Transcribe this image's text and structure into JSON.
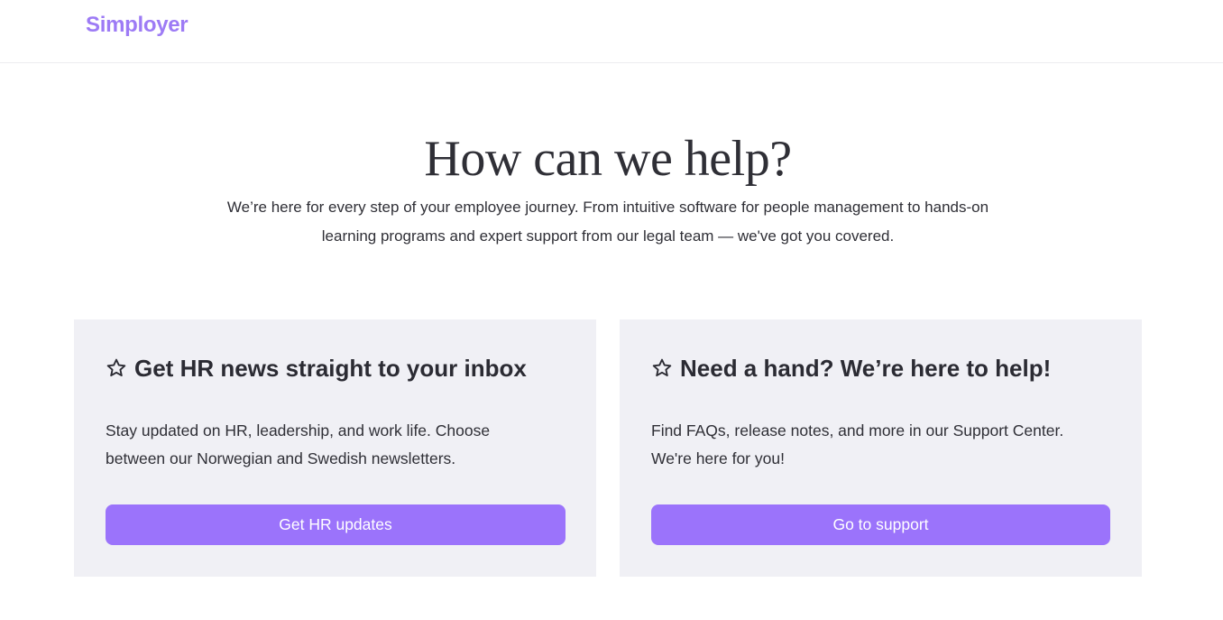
{
  "header": {
    "logo_text": "Simployer"
  },
  "hero": {
    "title": "How can we help?",
    "subtitle_line1": "We’re here for every step of your employee journey. From intuitive software for people management to hands-on",
    "subtitle_line2": "learning programs and expert support from our legal team — we've got you covered."
  },
  "cards": [
    {
      "icon": "star-icon",
      "title": "Get HR news straight to your inbox",
      "text_line1": "Stay updated on HR, leadership, and work life. Choose",
      "text_line2": "between our Norwegian and Swedish newsletters.",
      "button_label": "Get HR updates"
    },
    {
      "icon": "star-icon",
      "title": "Need a hand? We’re here to help!",
      "text_line1": "Find FAQs, release notes, and more in our Support Center.",
      "text_line2": "We're here for you!",
      "button_label": "Go to support"
    }
  ],
  "colors": {
    "brand": "#9d7bf5",
    "button": "#9b73fb",
    "card_background": "#f0f0f5",
    "text": "#2b2b33"
  }
}
